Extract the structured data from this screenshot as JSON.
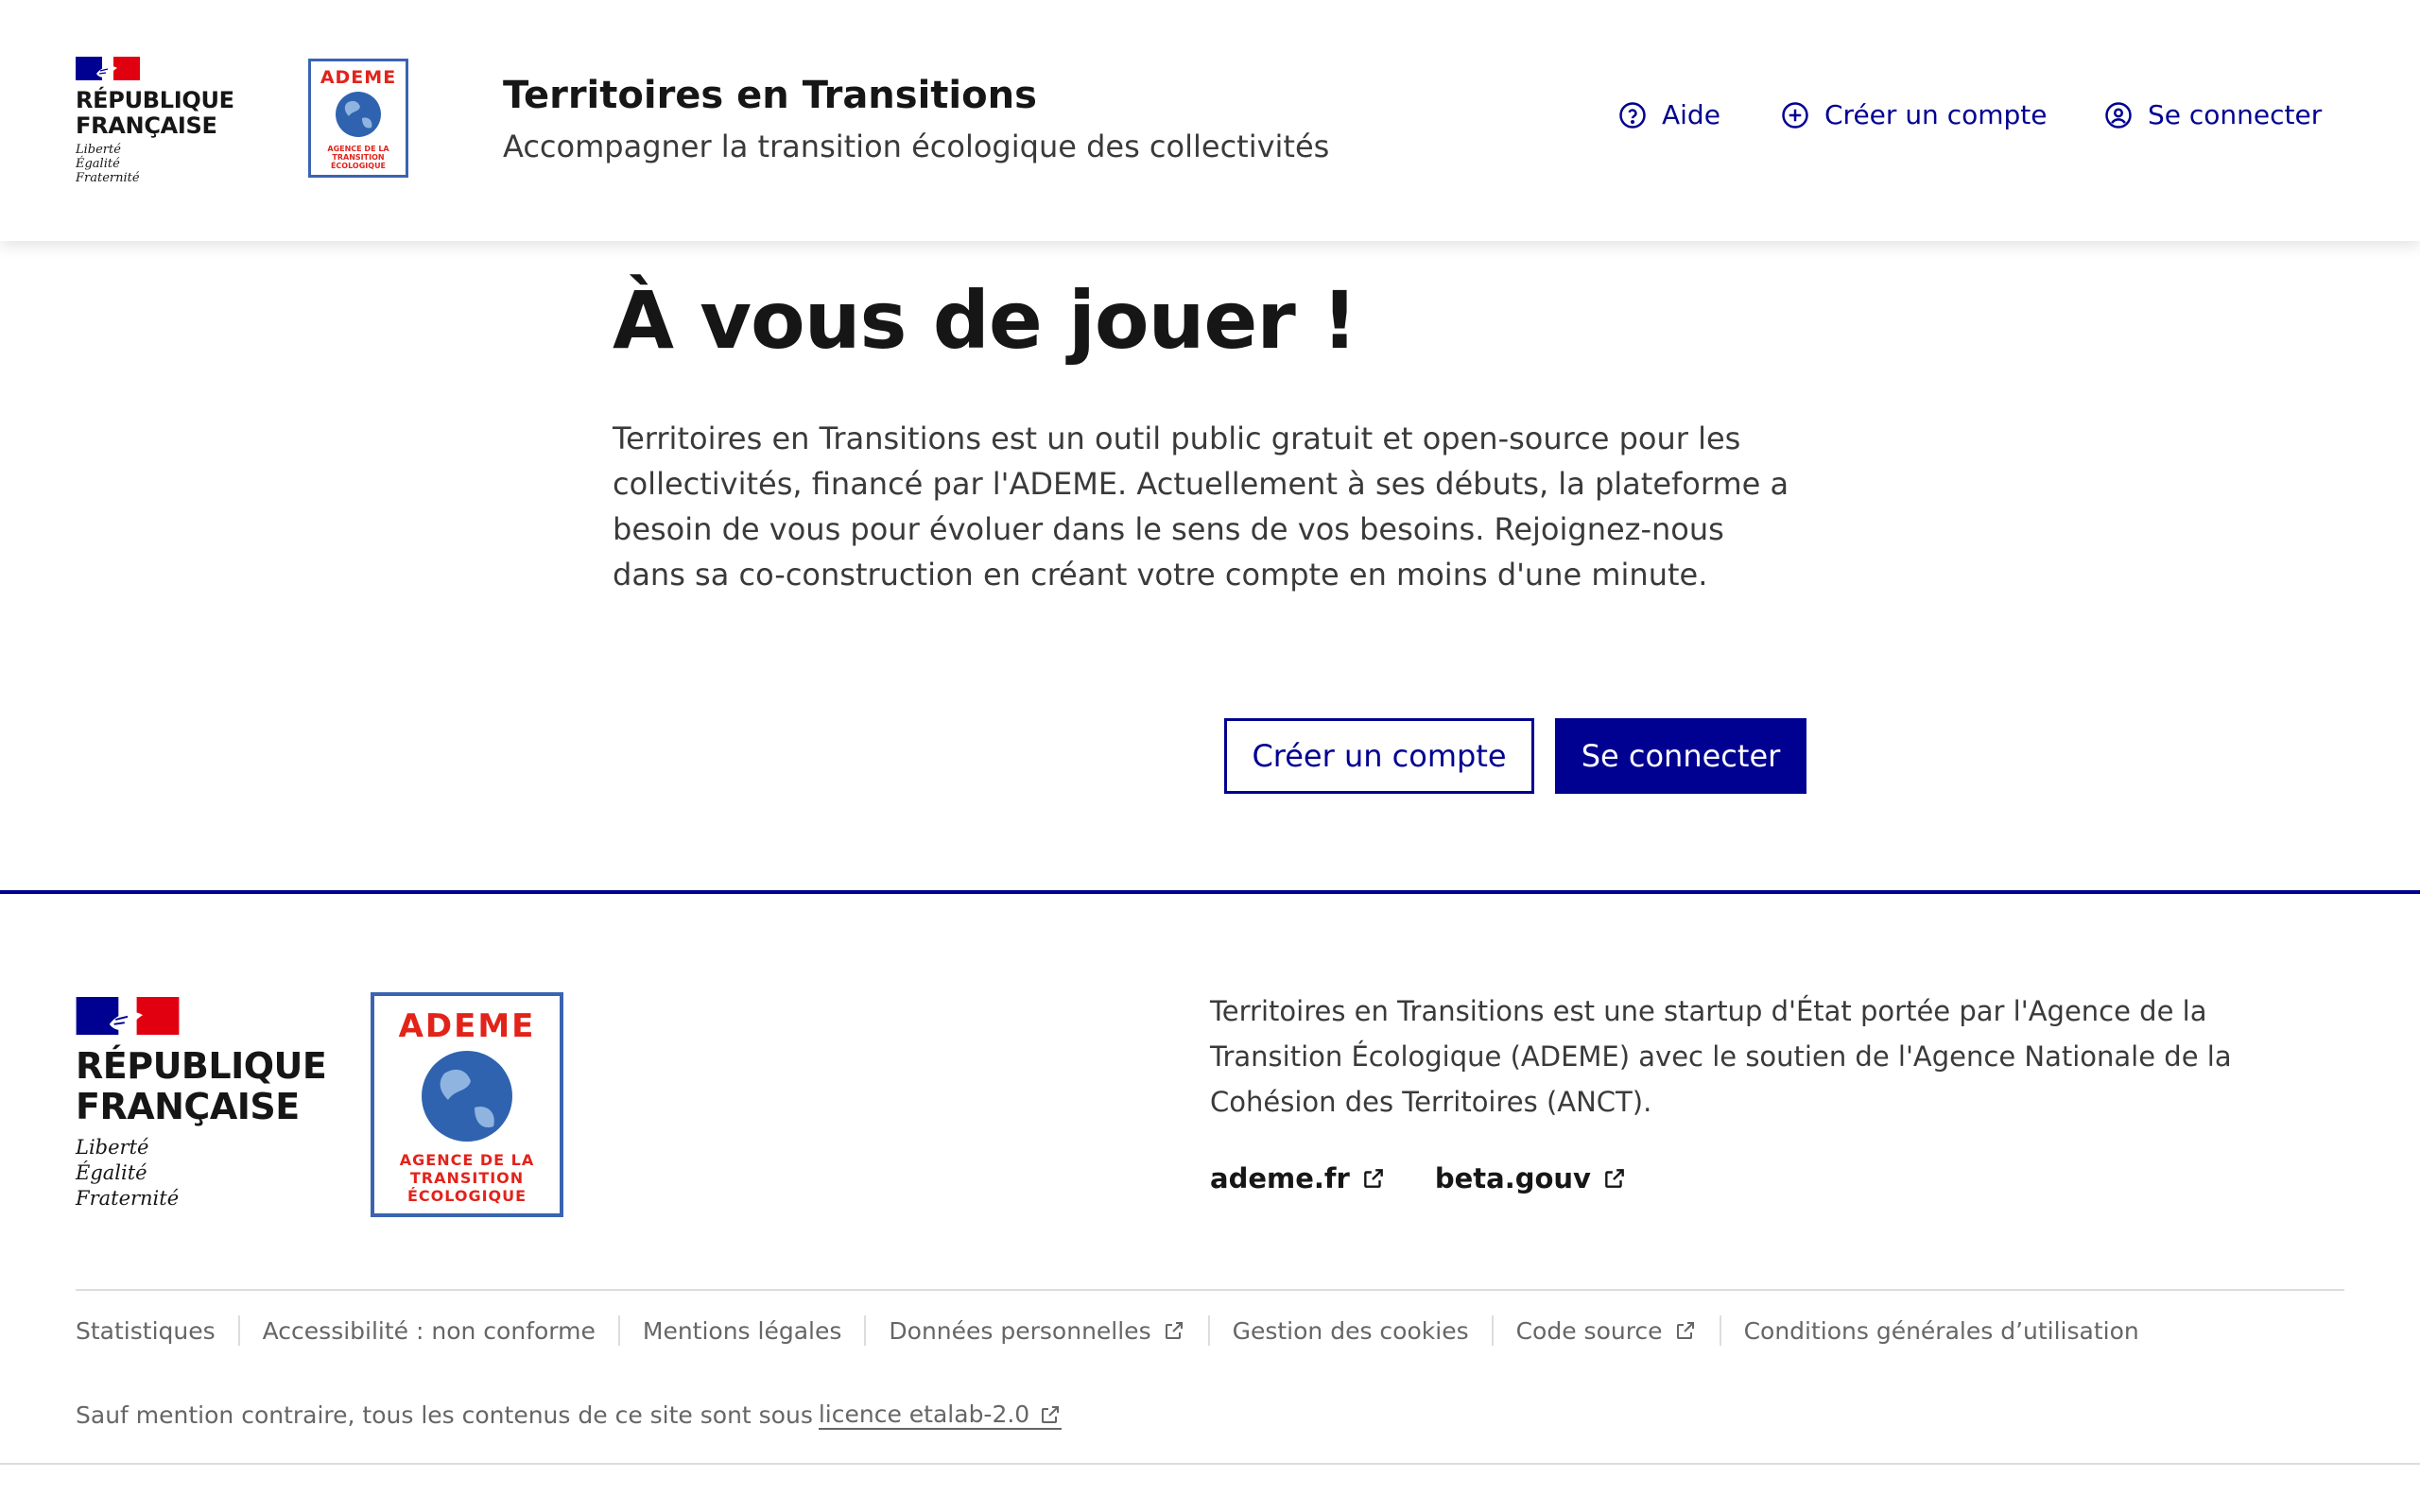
{
  "header": {
    "republic": {
      "line1": "RÉPUBLIQUE",
      "line2": "FRANÇAISE",
      "motto1": "Liberté",
      "motto2": "Égalité",
      "motto3": "Fraternité"
    },
    "ademe_logo": {
      "name": "ADEME",
      "line1": "AGENCE DE LA",
      "line2": "TRANSITION",
      "line3": "ÉCOLOGIQUE"
    },
    "site_title": "Territoires en Transitions",
    "site_tagline": "Accompagner la transition écologique des collectivités",
    "nav": {
      "help": "Aide",
      "create_account": "Créer un compte",
      "login": "Se connecter"
    }
  },
  "main": {
    "title": "À vous de jouer !",
    "intro": "Territoires en Transitions est un outil public gratuit et open-source pour les collectivités, financé par l'ADEME. Actuellement à ses débuts, la plateforme a besoin de vous pour évoluer dans le sens de vos besoins. Rejoignez-nous dans sa co-construction en créant votre compte en moins d'une minute.",
    "create_account_button": "Créer un compte",
    "login_button": "Se connecter"
  },
  "footer": {
    "republic": {
      "line1": "RÉPUBLIQUE",
      "line2": "FRANÇAISE",
      "motto1": "Liberté",
      "motto2": "Égalité",
      "motto3": "Fraternité"
    },
    "ademe_logo": {
      "name": "ADEME",
      "line1": "AGENCE DE LA",
      "line2": "TRANSITION",
      "line3": "ÉCOLOGIQUE"
    },
    "description": "Territoires en Transitions est une startup d'État portée par l'Agence de la Transition Écologique (ADEME) avec le soutien de l'Agence Nationale de la Cohésion des Territoires (ANCT).",
    "links": {
      "ademe": "ademe.fr",
      "beta": "beta.gouv"
    },
    "bottom_links": {
      "stats": "Statistiques",
      "accessibility": "Accessibilité : non conforme",
      "legal": "Mentions légales",
      "personal_data": "Données personnelles",
      "cookies": "Gestion des cookies",
      "source": "Code source",
      "terms": "Conditions générales d’utilisation"
    },
    "license_text": "Sauf mention contraire, tous les contenus de ce site sont sous",
    "license_link": "licence etalab-2.0"
  },
  "colors": {
    "primary": "#000091",
    "marianne_red": "#e1000f",
    "ademe_red": "#e2231a",
    "ademe_blue": "#3b64b0",
    "text": "#161616",
    "muted": "#666666"
  },
  "icons": [
    "question-circle-icon",
    "add-circle-icon",
    "user-circle-icon",
    "external-link-icon"
  ]
}
